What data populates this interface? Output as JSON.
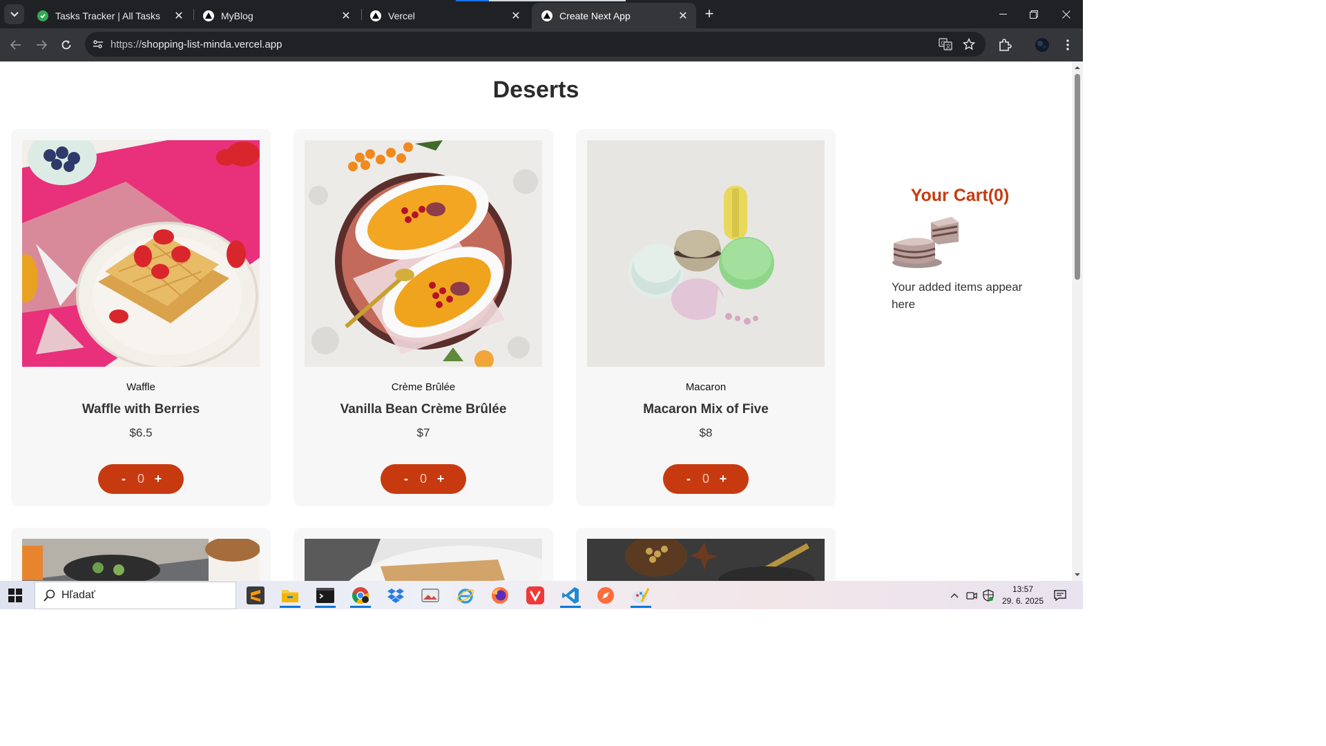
{
  "browser": {
    "tabs": [
      {
        "title": "Tasks Tracker | All Tasks",
        "favicon": "check-circle-icon",
        "active": false
      },
      {
        "title": "MyBlog",
        "favicon": "vercel-triangle-icon",
        "active": false
      },
      {
        "title": "Vercel",
        "favicon": "vercel-triangle-icon",
        "active": false
      },
      {
        "title": "Create Next App",
        "favicon": "vercel-triangle-icon",
        "active": true
      }
    ],
    "url_scheme": "https://",
    "url_host": "shopping-list-minda.vercel.app"
  },
  "page": {
    "title": "Deserts",
    "products": [
      {
        "category": "Waffle",
        "name": "Waffle with Berries",
        "price": "$6.5",
        "quantity": "0"
      },
      {
        "category": "Crème Brûlée",
        "name": "Vanilla Bean Crème Brûlée",
        "price": "$7",
        "quantity": "0"
      },
      {
        "category": "Macaron",
        "name": "Macaron Mix of Five",
        "price": "$8",
        "quantity": "0"
      }
    ],
    "qty_minus": "-",
    "qty_plus": "+",
    "cart": {
      "title": "Your Cart(0)",
      "empty_text": "Your added items appear here"
    }
  },
  "colors": {
    "accent": "#c73a0f",
    "card_bg": "#f7f7f7",
    "chrome_dark": "#202124",
    "chrome_toolbar": "#35363a"
  },
  "taskbar": {
    "search_placeholder": "Hľadať",
    "time": "13:57",
    "date": "29. 6. 2025",
    "apps": [
      "sublime-text-icon",
      "file-explorer-icon",
      "terminal-icon",
      "chrome-icon",
      "dropbox-icon",
      "photos-icon",
      "internet-explorer-icon",
      "firefox-icon",
      "vivaldi-icon",
      "vscode-icon",
      "compass-icon",
      "paint-icon"
    ]
  }
}
